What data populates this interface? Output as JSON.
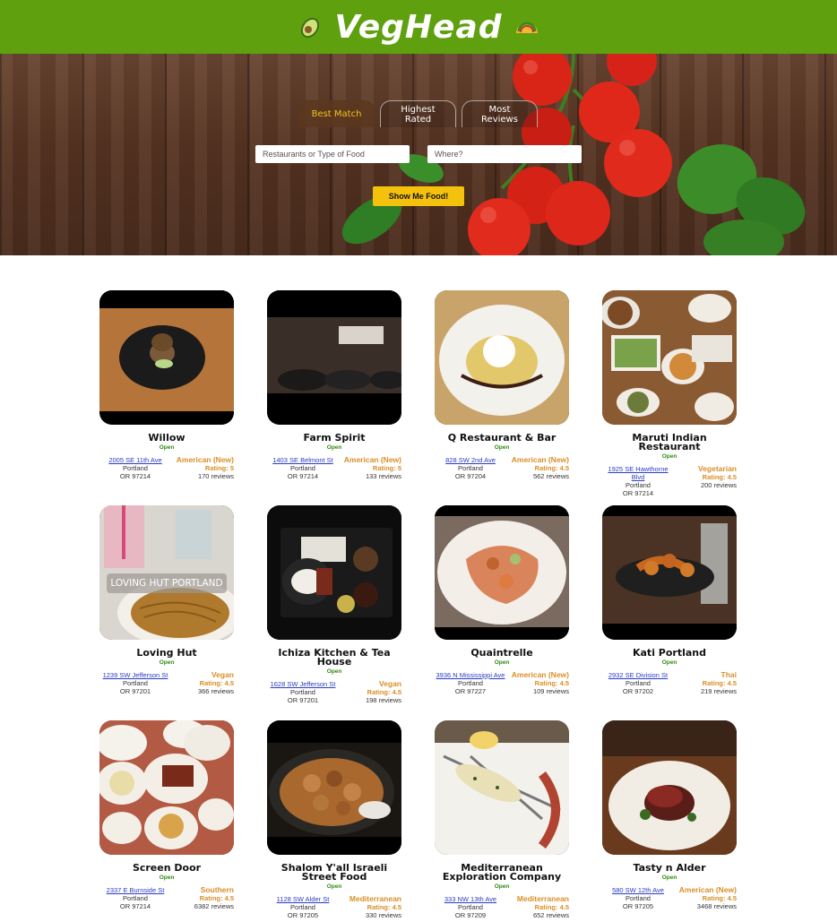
{
  "brand": {
    "title": "VegHead",
    "icon_left": "avocado-icon",
    "icon_right": "taco-icon"
  },
  "colors": {
    "header": "#5fa00f",
    "accent": "#f4c20d",
    "open": "#2e8b13",
    "category": "#d98f27",
    "link": "#2a3cc4"
  },
  "search": {
    "tabs": [
      {
        "label": "Best Match",
        "active": true
      },
      {
        "label": "Highest Rated",
        "active": false
      },
      {
        "label": "Most Reviews",
        "active": false
      }
    ],
    "what_placeholder": "Restaurants or Type of Food",
    "where_placeholder": "Where?",
    "submit_label": "Show Me Food!"
  },
  "restaurants": [
    {
      "name": "Willow",
      "status": "Open",
      "street": "2005 SE 11th Ave",
      "city": "Portland",
      "statezip": "OR 97214",
      "category": "American (New)",
      "rating": "Rating: 5",
      "reviews": "170 reviews",
      "photo": "dish-willow"
    },
    {
      "name": "Farm Spirit",
      "status": "Open",
      "street": "1403 SE Belmont St",
      "city": "Portland",
      "statezip": "OR 97214",
      "category": "American (New)",
      "rating": "Rating: 5",
      "reviews": "133 reviews",
      "photo": "dish-farm-spirit"
    },
    {
      "name": "Q Restaurant & Bar",
      "status": "Open",
      "street": "828 SW 2nd Ave",
      "city": "Portland",
      "statezip": "OR 97204",
      "category": "American (New)",
      "rating": "Rating: 4.5",
      "reviews": "562 reviews",
      "photo": "dish-q-restaurant"
    },
    {
      "name": "Maruti Indian Restaurant",
      "status": "Open",
      "street": "1925 SE Hawthorne Blvd",
      "city": "Portland",
      "statezip": "OR 97214",
      "category": "Vegetarian",
      "rating": "Rating: 4.5",
      "reviews": "200 reviews",
      "photo": "dish-maruti"
    },
    {
      "name": "Loving Hut",
      "status": "Open",
      "street": "1239 SW Jefferson St",
      "city": "Portland",
      "statezip": "OR 97201",
      "category": "Vegan",
      "rating": "Rating: 4.5",
      "reviews": "366 reviews",
      "photo": "dish-loving-hut",
      "overlay": "LOVING HUT PORTLAND"
    },
    {
      "name": "Ichiza Kitchen & Tea House",
      "status": "Open",
      "street": "1628 SW Jefferson St",
      "city": "Portland",
      "statezip": "OR 97201",
      "category": "Vegan",
      "rating": "Rating: 4.5",
      "reviews": "198 reviews",
      "photo": "dish-ichiza"
    },
    {
      "name": "Quaintrelle",
      "status": "Open",
      "street": "3936 N Mississippi Ave",
      "city": "Portland",
      "statezip": "OR 97227",
      "category": "American (New)",
      "rating": "Rating: 4.5",
      "reviews": "109 reviews",
      "photo": "dish-quaintrelle"
    },
    {
      "name": "Kati Portland",
      "status": "Open",
      "street": "2932 SE Division St",
      "city": "Portland",
      "statezip": "OR 97202",
      "category": "Thai",
      "rating": "Rating: 4.5",
      "reviews": "219 reviews",
      "photo": "dish-kati"
    },
    {
      "name": "Screen Door",
      "status": "Open",
      "street": "2337 E Burnside St",
      "city": "Portland",
      "statezip": "OR 97214",
      "category": "Southern",
      "rating": "Rating: 4.5",
      "reviews": "6382 reviews",
      "photo": "dish-screen-door"
    },
    {
      "name": "Shalom Y'all Israeli Street Food",
      "status": "Open",
      "street": "1128 SW Alder St",
      "city": "Portland",
      "statezip": "OR 97205",
      "category": "Mediterranean",
      "rating": "Rating: 4.5",
      "reviews": "330 reviews",
      "photo": "dish-shalom-yall"
    },
    {
      "name": "Mediterranean Exploration Company",
      "status": "Open",
      "street": "333 NW 13th Ave",
      "city": "Portland",
      "statezip": "OR 97209",
      "category": "Mediterranean",
      "rating": "Rating: 4.5",
      "reviews": "652 reviews",
      "photo": "dish-mediterranean-exploration"
    },
    {
      "name": "Tasty n Alder",
      "status": "Open",
      "street": "580 SW 12th Ave",
      "city": "Portland",
      "statezip": "OR 97205",
      "category": "American (New)",
      "rating": "Rating: 4.5",
      "reviews": "3468 reviews",
      "photo": "dish-tasty-n-alder"
    }
  ]
}
